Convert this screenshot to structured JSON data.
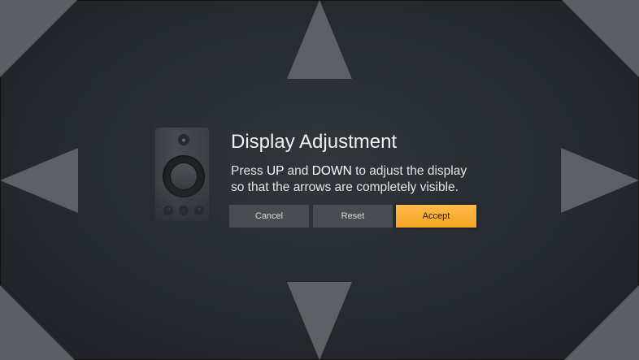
{
  "dialog": {
    "title": "Display Adjustment",
    "instruction_parts": {
      "p1": "Press ",
      "up": "UP",
      "p2": " and ",
      "down": "DOWN",
      "p3": " to adjust the display",
      "line2": "so that the arrows are completely visible."
    }
  },
  "buttons": {
    "cancel": "Cancel",
    "reset": "Reset",
    "accept": "Accept"
  },
  "icons": {
    "arrows": [
      "arrow-up-icon",
      "arrow-down-icon",
      "arrow-left-icon",
      "arrow-right-icon"
    ],
    "corners": [
      "corner-top-left-icon",
      "corner-top-right-icon",
      "corner-bottom-left-icon",
      "corner-bottom-right-icon"
    ],
    "remote": "remote-control-icon"
  },
  "colors": {
    "background": "#272c31",
    "arrow": "#5d6165",
    "button": "#494d52",
    "accent": "#f5a623"
  }
}
